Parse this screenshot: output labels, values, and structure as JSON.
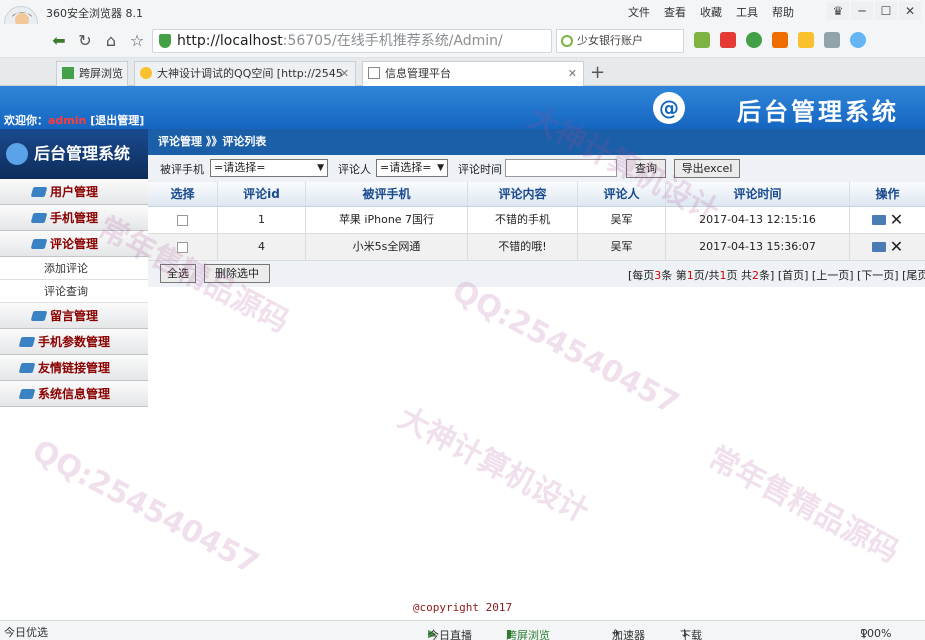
{
  "browser": {
    "app_title": "360安全浏览器 8.1",
    "menu": [
      "文件",
      "查看",
      "收藏",
      "工具",
      "帮助"
    ],
    "url_host": "http://localhost",
    "url_rest": ":56705/在线手机推荐系统/Admin/",
    "search_text": "少女银行账户",
    "tabs": [
      {
        "label": "跨屏浏览"
      },
      {
        "label": "大神设计调试的QQ空间 [http://2545"
      },
      {
        "label": "信息管理平台"
      }
    ]
  },
  "banner": {
    "title": "后台管理系统",
    "welcome_prefix": "欢迎你：",
    "username": "admin",
    "logout": "[退出管理]"
  },
  "sidebar": {
    "title": "后台管理系统",
    "items": [
      {
        "label": "用户管理",
        "type": "category"
      },
      {
        "label": "手机管理",
        "type": "category"
      },
      {
        "label": "评论管理",
        "type": "category"
      },
      {
        "label": "添加评论",
        "type": "sub"
      },
      {
        "label": "评论查询",
        "type": "sub"
      },
      {
        "label": "留言管理",
        "type": "category"
      },
      {
        "label": "手机参数管理",
        "type": "category"
      },
      {
        "label": "友情链接管理",
        "type": "category"
      },
      {
        "label": "系统信息管理",
        "type": "category"
      }
    ]
  },
  "breadcrumb": "评论管理 》》评论列表",
  "filter": {
    "phone_label": "被评手机",
    "phone_value": "=请选择=",
    "person_label": "评论人",
    "person_value": "=请选择=",
    "time_label": "评论时间",
    "time_value": "",
    "search_btn": "查询",
    "export_btn": "导出excel"
  },
  "table": {
    "headers": [
      "选择",
      "评论id",
      "被评手机",
      "评论内容",
      "评论人",
      "评论时间",
      "操作"
    ],
    "rows": [
      {
        "id": "1",
        "phone": "苹果 iPhone 7国行",
        "content": "不错的手机",
        "person": "吴军",
        "time": "2017-04-13 12:15:16"
      },
      {
        "id": "4",
        "phone": "小米5s全网通",
        "content": "不错的哦!",
        "person": "吴军",
        "time": "2017-04-13 15:36:07"
      }
    ]
  },
  "actions": {
    "select_all": "全选",
    "delete_selected": "删除选中"
  },
  "pager": {
    "t1": "[每页",
    "per_page": "3",
    "t2": "条 第",
    "current": "1",
    "t3": "页/共",
    "pages": "1",
    "t4": "页 共",
    "total": "2",
    "t5": "条]",
    "first": "[首页]",
    "prev": "[上一页]",
    "next": "[下一页]",
    "last": "[尾页"
  },
  "copyright": "@copyright 2017",
  "statusbar": {
    "left": "今日优选",
    "live": "今日直播",
    "cross": "跨屏浏览",
    "accel": "加速器",
    "download": "下载",
    "zoom": "100%"
  },
  "watermarks": [
    "QQ:254540457",
    "大神计算机设计",
    "常年售精品源码"
  ]
}
